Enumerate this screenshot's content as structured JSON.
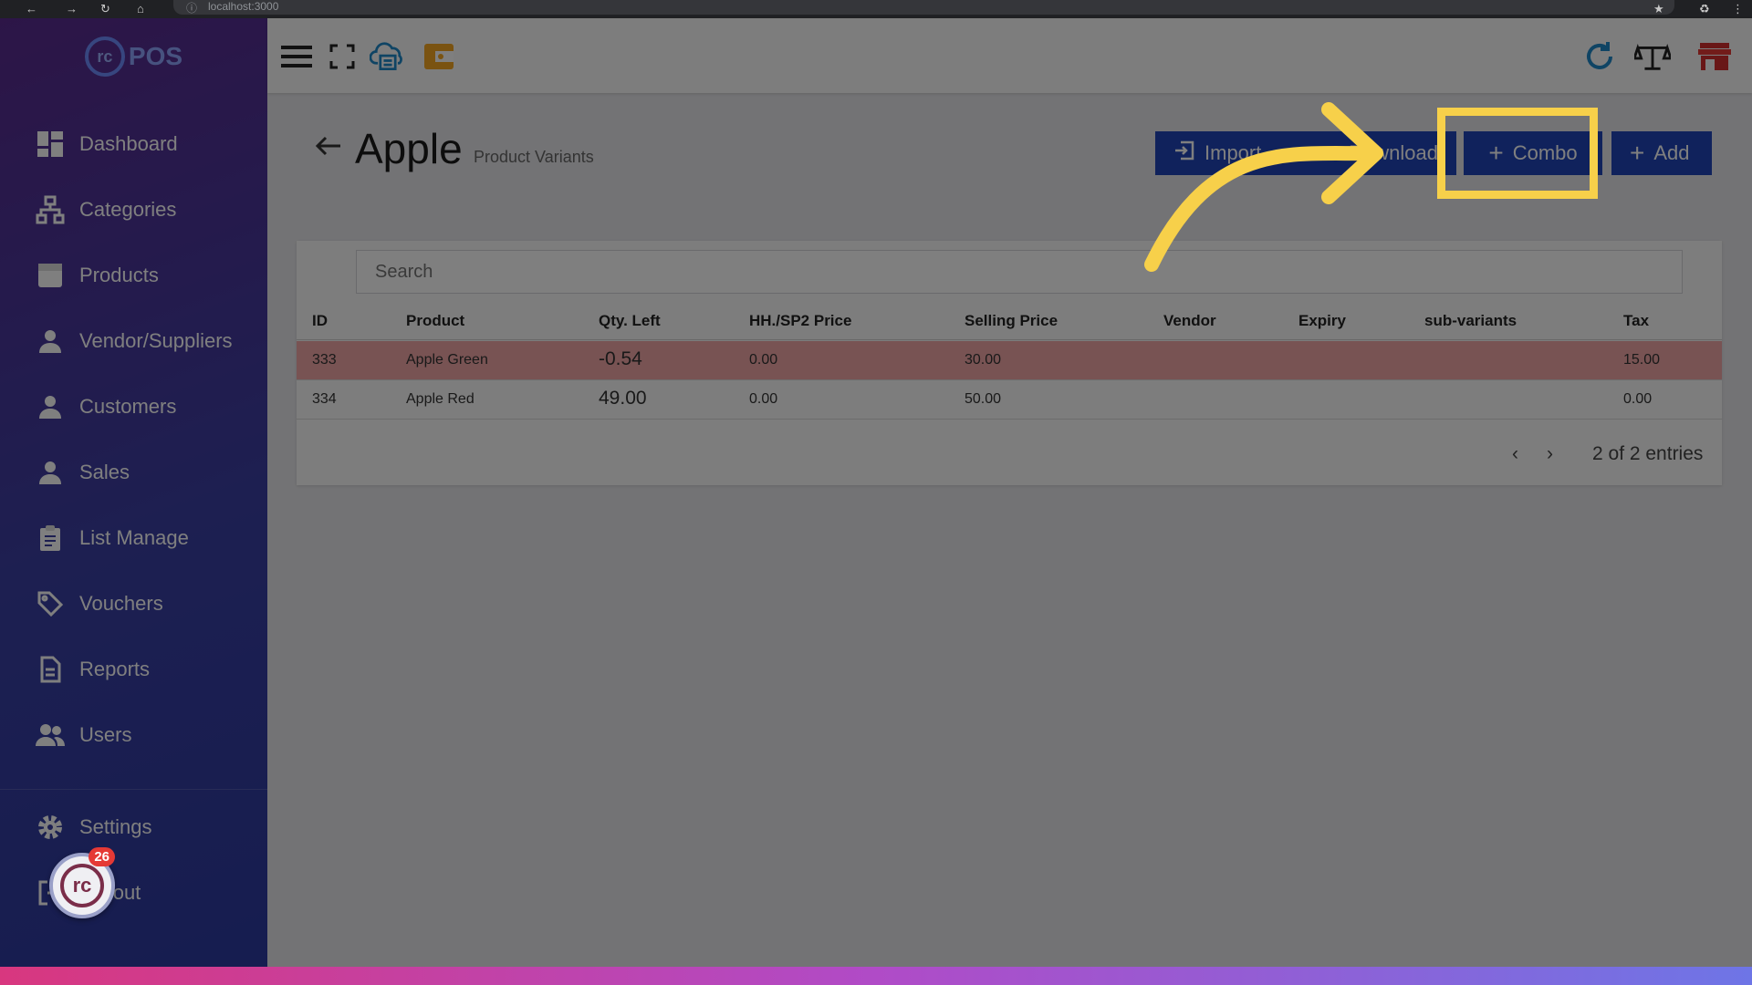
{
  "browser": {
    "url": "localhost:3000"
  },
  "brand": {
    "logo_mark": "rc",
    "logo_text": "POS"
  },
  "sidebar": {
    "items": [
      {
        "label": "Dashboard",
        "icon": "dashboard-icon"
      },
      {
        "label": "Categories",
        "icon": "sitemap-icon"
      },
      {
        "label": "Products",
        "icon": "box-icon"
      },
      {
        "label": "Vendor/Suppliers",
        "icon": "person-icon"
      },
      {
        "label": "Customers",
        "icon": "person-icon"
      },
      {
        "label": "Sales",
        "icon": "person-icon"
      },
      {
        "label": "List Manage",
        "icon": "clipboard-icon"
      },
      {
        "label": "Vouchers",
        "icon": "tag-icon"
      },
      {
        "label": "Reports",
        "icon": "document-icon"
      },
      {
        "label": "Users",
        "icon": "users-icon"
      }
    ],
    "settings_label": "Settings",
    "logout_label": "Logout"
  },
  "notification": {
    "count": "26"
  },
  "page": {
    "title": "Apple",
    "subtitle": "Product Variants"
  },
  "actions": {
    "import_label": "Import",
    "download_label": "Download",
    "combo_label": "Combo",
    "add_label": "Add"
  },
  "search": {
    "placeholder": "Search"
  },
  "table": {
    "columns": [
      "ID",
      "Product",
      "Qty. Left",
      "HH./SP2 Price",
      "Selling Price",
      "Vendor",
      "Expiry",
      "sub-variants",
      "Tax"
    ],
    "rows": [
      {
        "id": "333",
        "product": "Apple Green",
        "qty": "-0.54",
        "hh_price": "0.00",
        "selling_price": "30.00",
        "vendor": "",
        "expiry": "",
        "sub_variants": "",
        "tax": "15.00"
      },
      {
        "id": "334",
        "product": "Apple Red",
        "qty": "49.00",
        "hh_price": "0.00",
        "selling_price": "50.00",
        "vendor": "",
        "expiry": "",
        "sub_variants": "",
        "tax": "0.00"
      }
    ]
  },
  "pagination": {
    "summary": "2 of 2 entries"
  },
  "colors": {
    "primary": "#2044b8",
    "highlight": "#f7d04a",
    "negative_row": "#f0a6a6",
    "sidebar_top": "#5a2b8f",
    "sidebar_bottom": "#2c3aa0"
  }
}
